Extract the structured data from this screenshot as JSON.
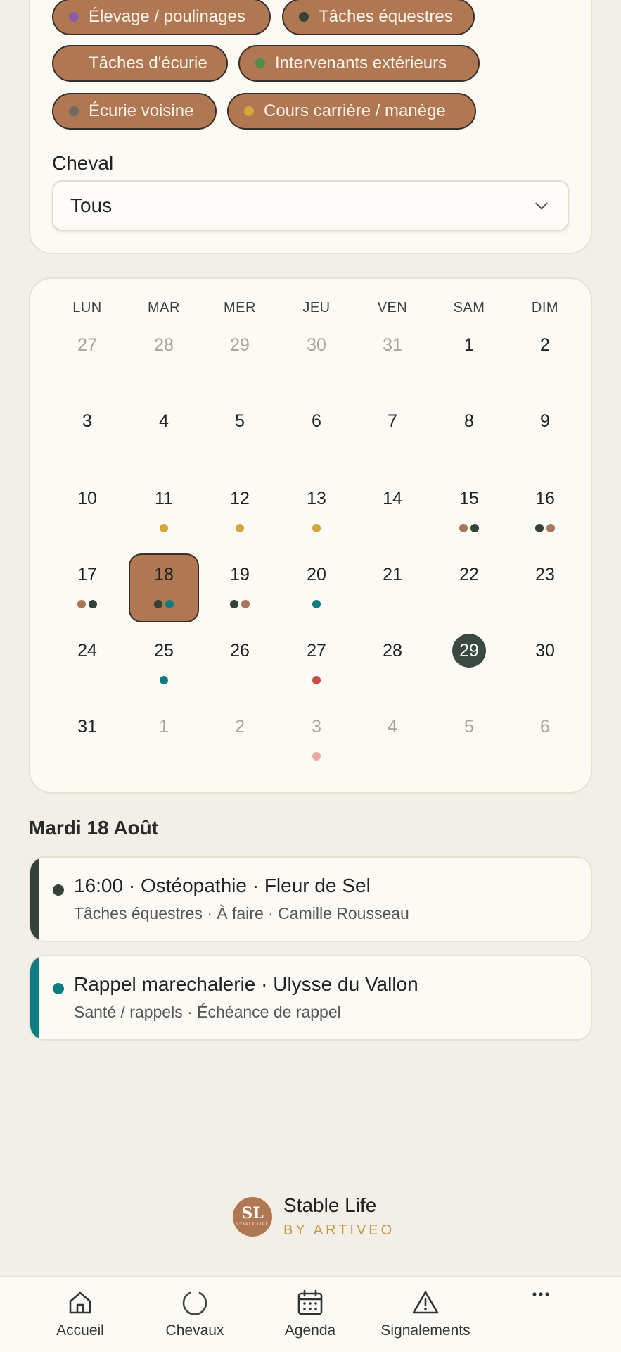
{
  "filters": {
    "chips": [
      {
        "label": "Élevage / poulinages",
        "color": "#8e5aa6"
      },
      {
        "label": "Tâches équestres",
        "color": "#344239"
      },
      {
        "label": "Tâches d'écurie",
        "color": null
      },
      {
        "label": "Intervenants extérieurs",
        "color": "#4f8c4a"
      },
      {
        "label": "Écurie voisine",
        "color": "#6f6a62"
      },
      {
        "label": "Cours carrière / manège",
        "color": "#d6a63a"
      }
    ],
    "horse_label": "Cheval",
    "horse_value": "Tous"
  },
  "calendar": {
    "weekdays": [
      "LUN",
      "MAR",
      "MER",
      "JEU",
      "VEN",
      "SAM",
      "DIM"
    ],
    "weeks": [
      [
        {
          "n": "27",
          "muted": true
        },
        {
          "n": "28",
          "muted": true
        },
        {
          "n": "29",
          "muted": true
        },
        {
          "n": "30",
          "muted": true
        },
        {
          "n": "31",
          "muted": true
        },
        {
          "n": "1"
        },
        {
          "n": "2"
        }
      ],
      [
        {
          "n": "3"
        },
        {
          "n": "4"
        },
        {
          "n": "5"
        },
        {
          "n": "6"
        },
        {
          "n": "7"
        },
        {
          "n": "8"
        },
        {
          "n": "9"
        }
      ],
      [
        {
          "n": "10"
        },
        {
          "n": "11",
          "dots": [
            "#d6a63a"
          ]
        },
        {
          "n": "12",
          "dots": [
            "#d6a63a"
          ]
        },
        {
          "n": "13",
          "dots": [
            "#d6a63a"
          ]
        },
        {
          "n": "14"
        },
        {
          "n": "15",
          "dots": [
            "#a87658",
            "#344239"
          ]
        },
        {
          "n": "16",
          "dots": [
            "#344239",
            "#a87658"
          ]
        }
      ],
      [
        {
          "n": "17",
          "dots": [
            "#a87658",
            "#344239"
          ]
        },
        {
          "n": "18",
          "selected": true,
          "dots": [
            "#344239",
            "#0e7c80"
          ]
        },
        {
          "n": "19",
          "dots": [
            "#344239",
            "#a87658"
          ]
        },
        {
          "n": "20",
          "dots": [
            "#0e7c80"
          ]
        },
        {
          "n": "21"
        },
        {
          "n": "22"
        },
        {
          "n": "23"
        }
      ],
      [
        {
          "n": "24"
        },
        {
          "n": "25",
          "dots": [
            "#0e7c80"
          ]
        },
        {
          "n": "26"
        },
        {
          "n": "27",
          "dots": [
            "#c84a4a"
          ]
        },
        {
          "n": "28"
        },
        {
          "n": "29",
          "today": true
        },
        {
          "n": "30"
        }
      ],
      [
        {
          "n": "31"
        },
        {
          "n": "1",
          "muted": true
        },
        {
          "n": "2",
          "muted": true
        },
        {
          "n": "3",
          "muted": true,
          "dots": [
            "#e6a9a6"
          ]
        },
        {
          "n": "4",
          "muted": true
        },
        {
          "n": "5",
          "muted": true
        },
        {
          "n": "6",
          "muted": true
        }
      ]
    ]
  },
  "selected_day": {
    "title": "Mardi 18 Août",
    "events": [
      {
        "title": "16:00 · Ostéopathie · Fleur de Sel",
        "subtitle": "Tâches équestres · À faire · Camille Rousseau",
        "color": "#344239"
      },
      {
        "title": "Rappel marechalerie · Ulysse du Vallon",
        "subtitle": "Santé / rappels · Échéance de rappel",
        "color": "#0e7c80"
      }
    ]
  },
  "brand": {
    "logo_initials": "SL",
    "logo_small": "STABLE LIFE",
    "name": "Stable Life",
    "byline": "BY ARTIVEO"
  },
  "nav": [
    {
      "label": "Accueil",
      "icon": "home-icon"
    },
    {
      "label": "Chevaux",
      "icon": "loading-icon"
    },
    {
      "label": "Agenda",
      "icon": "calendar-icon"
    },
    {
      "label": "Signalements",
      "icon": "warning-icon"
    },
    {
      "label": "",
      "icon": "more-icon"
    }
  ]
}
